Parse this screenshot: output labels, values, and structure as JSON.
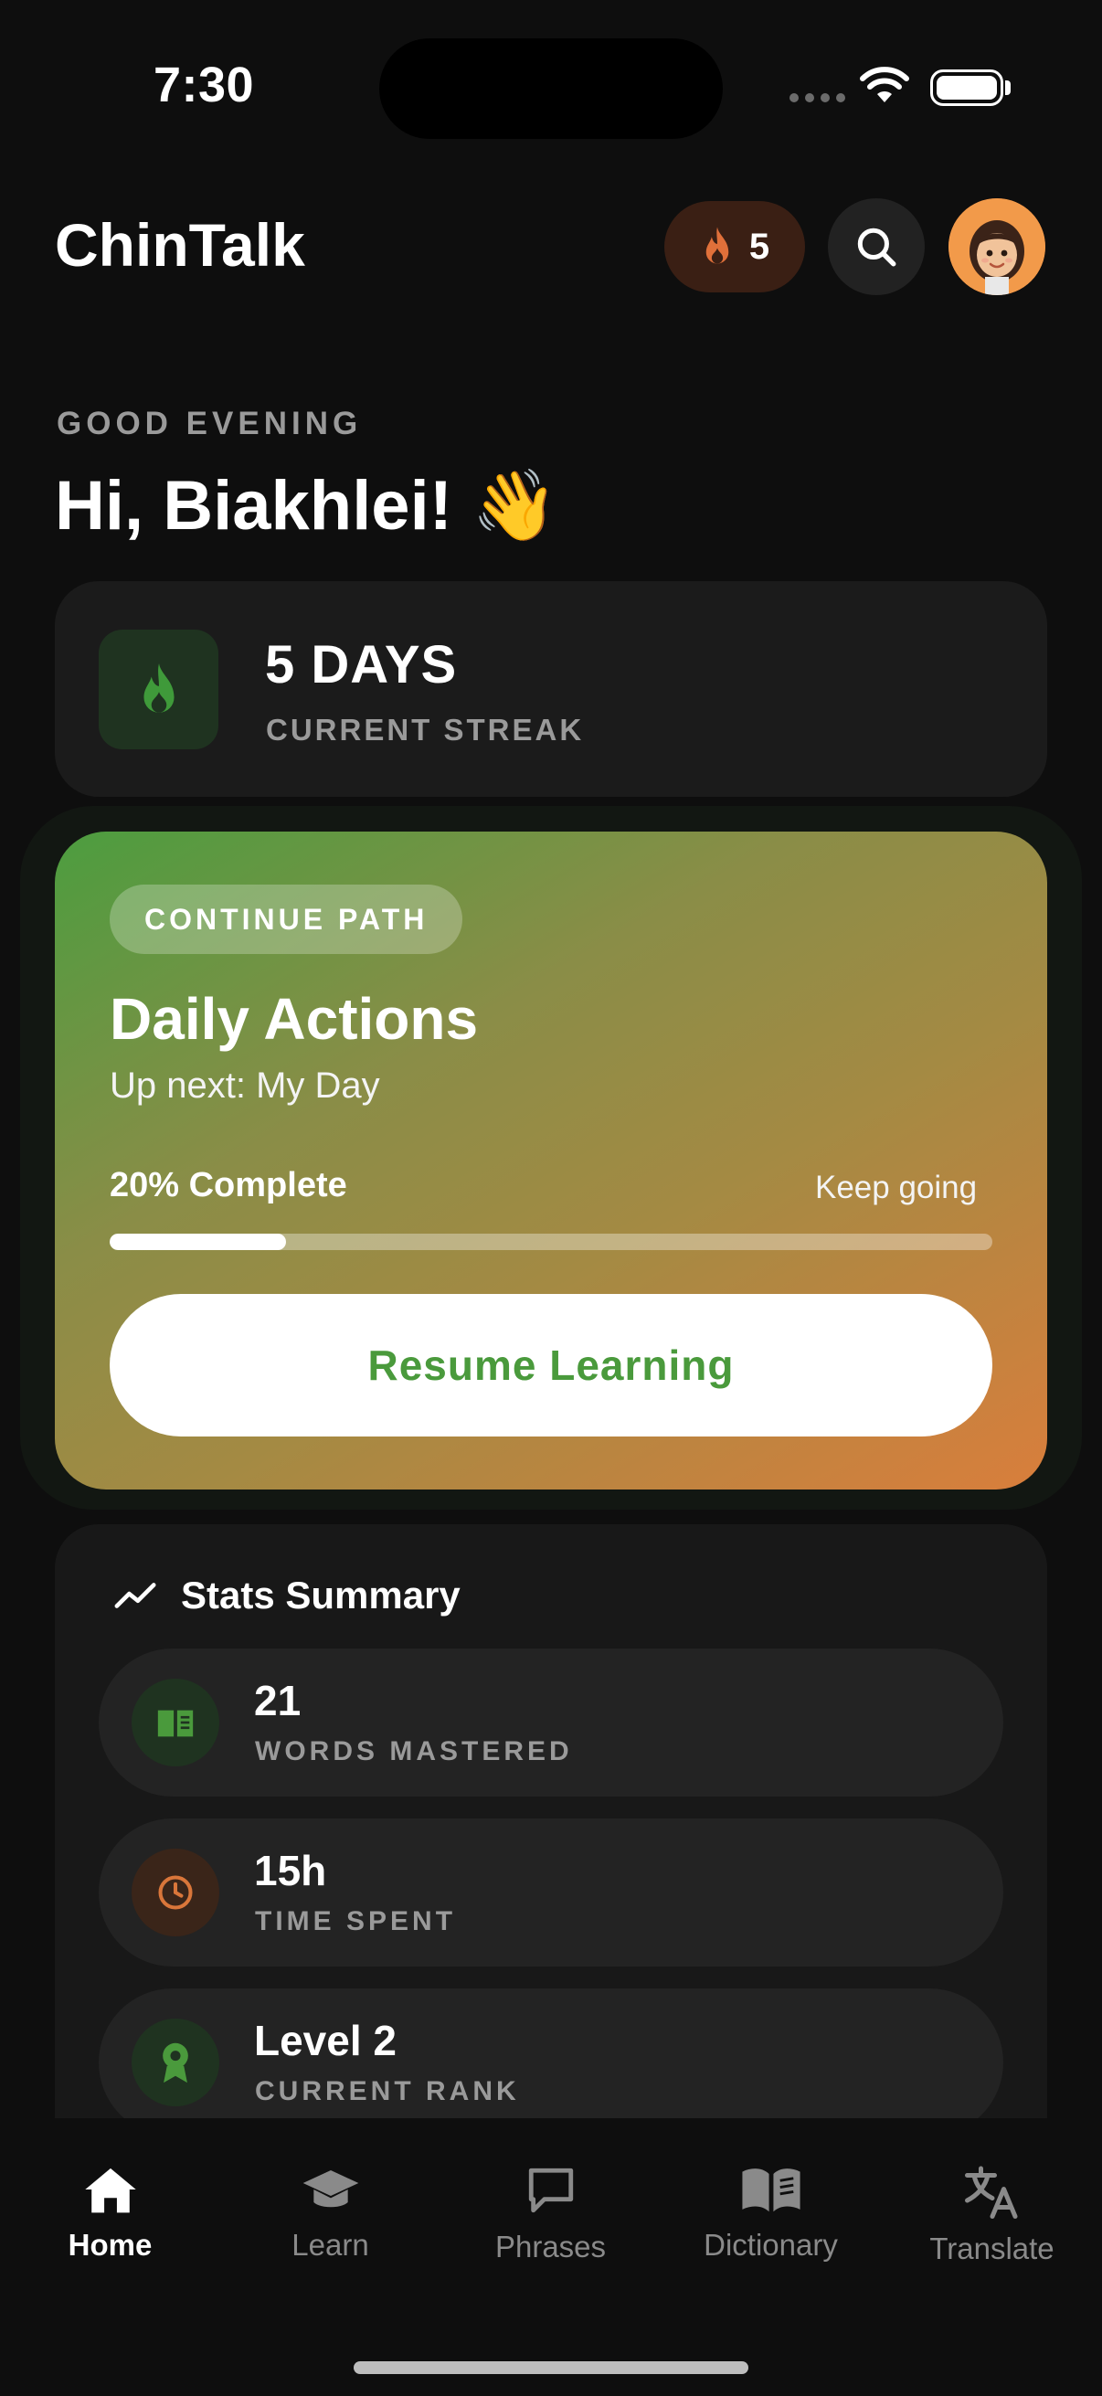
{
  "status_bar": {
    "time": "7:30"
  },
  "header": {
    "app_title": "ChinTalk",
    "streak_count": "5"
  },
  "greeting": {
    "subtitle": "GOOD EVENING",
    "title": "Hi, Biakhlei! 👋"
  },
  "streak_card": {
    "days": "5 DAYS",
    "label": "CURRENT STREAK"
  },
  "path_card": {
    "chip": "CONTINUE PATH",
    "title": "Daily Actions",
    "subtitle": "Up next: My Day",
    "progress_text": "20% Complete",
    "progress_hint": "Keep going",
    "progress_value": 0.2,
    "button": "Resume Learning"
  },
  "stats": {
    "title": "Stats Summary",
    "items": [
      {
        "value": "21",
        "label": "WORDS MASTERED",
        "icon": "book-icon",
        "color": "#4a9a3c"
      },
      {
        "value": "15h",
        "label": "TIME SPENT",
        "icon": "clock-icon",
        "color": "#d9763a"
      },
      {
        "value": "Level 2",
        "label": "CURRENT RANK",
        "icon": "award-icon",
        "color": "#4a9a3c"
      }
    ]
  },
  "tabs": [
    {
      "label": "Home",
      "icon": "home-icon",
      "active": true
    },
    {
      "label": "Learn",
      "icon": "graduation-cap-icon",
      "active": false
    },
    {
      "label": "Phrases",
      "icon": "chat-bubble-icon",
      "active": false
    },
    {
      "label": "Dictionary",
      "icon": "open-book-icon",
      "active": false
    },
    {
      "label": "Translate",
      "icon": "translate-icon",
      "active": false
    }
  ],
  "colors": {
    "background": "#0e0e0e",
    "accent_green": "#4a9a3c",
    "accent_orange": "#d9763a"
  }
}
